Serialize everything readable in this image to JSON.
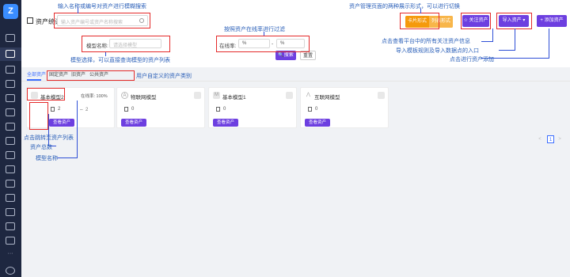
{
  "header": {
    "title": "资产统计",
    "search_placeholder": "输入资产编号或资产名称搜索",
    "toggle": {
      "card": "卡片形式",
      "list": "列表形式"
    },
    "buttons": {
      "follow": "关注资产",
      "import": "导入资产",
      "add": "添加资产"
    }
  },
  "filter": {
    "model_label": "模型名称:",
    "model_placeholder": "请选择模型",
    "online_label": "在线率:",
    "unit1": "%",
    "dash": "-",
    "unit2": "%",
    "search_btn": "搜索",
    "reset_btn": "重置"
  },
  "tabs": [
    "全部资产",
    "固定资产",
    "旧资产",
    "公共资产"
  ],
  "cards": [
    {
      "name": "基本模型2",
      "avatar": "",
      "count": "2",
      "online": "在线率: 100%",
      "wifi": "2",
      "button": "查看资产"
    },
    {
      "name": "物联网模型",
      "avatar": "A",
      "count": "0",
      "button": "查看资产"
    },
    {
      "name": "基本模型1",
      "avatar": "M",
      "count": "0",
      "button": "查看资产"
    },
    {
      "name": "互联网模型",
      "avatar": "",
      "count": "0",
      "button": "查看资产"
    }
  ],
  "pager": {
    "prev": "<",
    "page": "1",
    "next": ">"
  },
  "annotations": {
    "search": "输入名称或编号对资产进行模糊搜索",
    "toggle": "资产管理页面的两种展示形式，可以进行切换",
    "online": "按照资产在线率进行过滤",
    "model": "模型选择，可以直接查询模型的资产列表",
    "tabs": "用户自定义的资产类别",
    "follow": "点击查看平台中的所有关注资产信息",
    "import": "导入模板规则及导入数据点的入口",
    "add": "点击进行资产添加",
    "view": "点击跳转至资产列表",
    "count": "资产总数",
    "name": "模型名称"
  }
}
